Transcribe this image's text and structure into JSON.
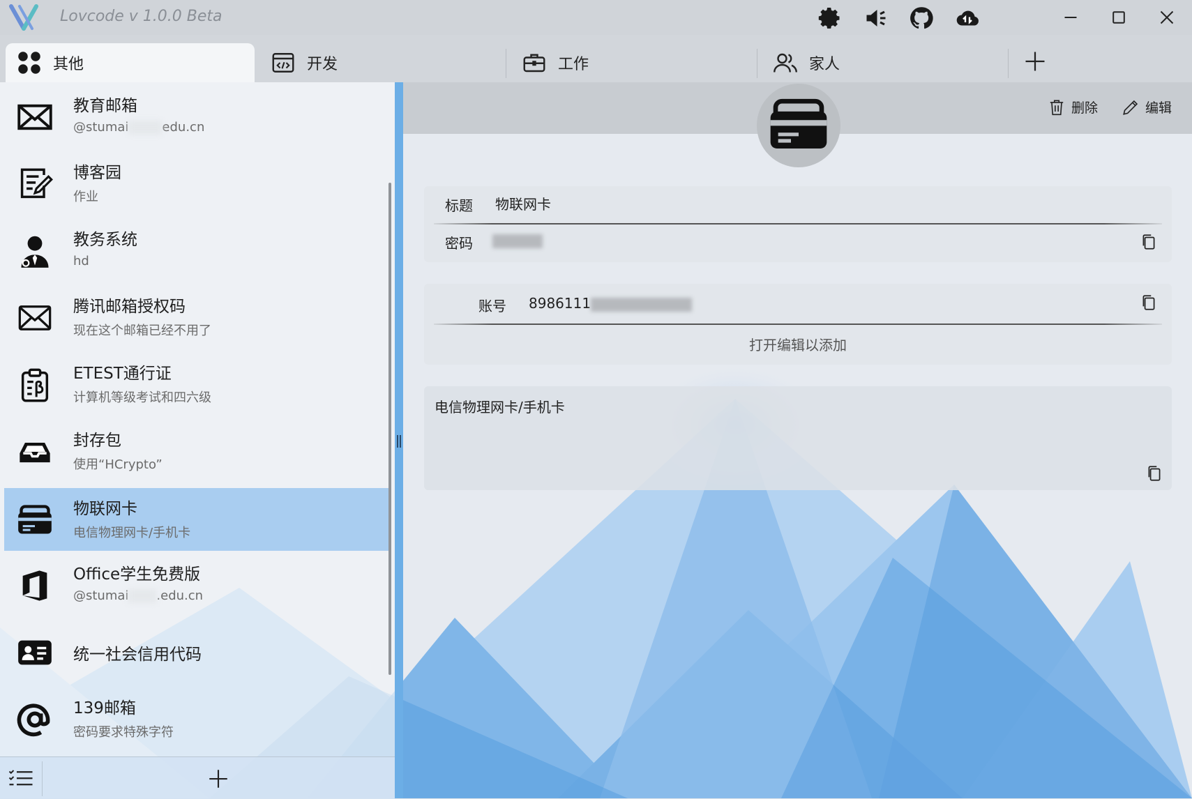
{
  "app": {
    "title": "Lovcode  v 1.0.0 Beta"
  },
  "toolbar": {
    "icons": [
      "gear-icon",
      "speaker-icon",
      "github-icon",
      "cloud-sync-icon"
    ]
  },
  "window_controls": [
    "minimize",
    "maximize",
    "close"
  ],
  "tabs": [
    {
      "label": "其他",
      "icon": "grid-icon",
      "active": true
    },
    {
      "label": "开发",
      "icon": "code-window-icon",
      "active": false
    },
    {
      "label": "工作",
      "icon": "briefcase-icon",
      "active": false
    },
    {
      "label": "家人",
      "icon": "people-icon",
      "active": false
    }
  ],
  "sidebar": {
    "items": [
      {
        "title": "教育邮箱",
        "subtitle_prefix": "@stumai",
        "subtitle_suffix": "edu.cn",
        "icon": "envelope-icon"
      },
      {
        "title": "博客园",
        "subtitle": "作业",
        "icon": "note-icon"
      },
      {
        "title": "教务系统",
        "subtitle": "hd",
        "icon": "user-tie-icon"
      },
      {
        "title": "腾讯邮箱授权码",
        "subtitle": "现在这个邮箱已经不用了",
        "icon": "envelope-icon"
      },
      {
        "title": "ETEST通行证",
        "subtitle": "计算机等级考试和四六级",
        "icon": "clipboard-icon"
      },
      {
        "title": "封存包",
        "subtitle": "使用“HCrypto”",
        "icon": "inbox-icon"
      },
      {
        "title": "物联网卡",
        "subtitle": "电信物理网卡/手机卡",
        "icon": "card-icon",
        "selected": true
      },
      {
        "title": "Office学生免费版",
        "subtitle_prefix": "@stumai",
        "subtitle_suffix": ".edu.cn",
        "icon": "office-icon"
      },
      {
        "title": "统一社会信用代码",
        "icon": "id-card-icon"
      },
      {
        "title": "139邮箱",
        "subtitle": "密码要求特殊字符",
        "icon": "at-icon"
      }
    ]
  },
  "detail": {
    "actions": {
      "delete": "删除",
      "edit": "编辑"
    },
    "fields": {
      "title_label": "标题",
      "title_value": "物联网卡",
      "password_label": "密码",
      "account_label": "账号",
      "account_value": "8986111"
    },
    "add_hint": "打开编辑以添加",
    "note": "电信物理网卡/手机卡"
  },
  "colors": {
    "accent": "#6caee6",
    "selected": "#a9cdf0",
    "titlebar": "#d0d4d9"
  }
}
